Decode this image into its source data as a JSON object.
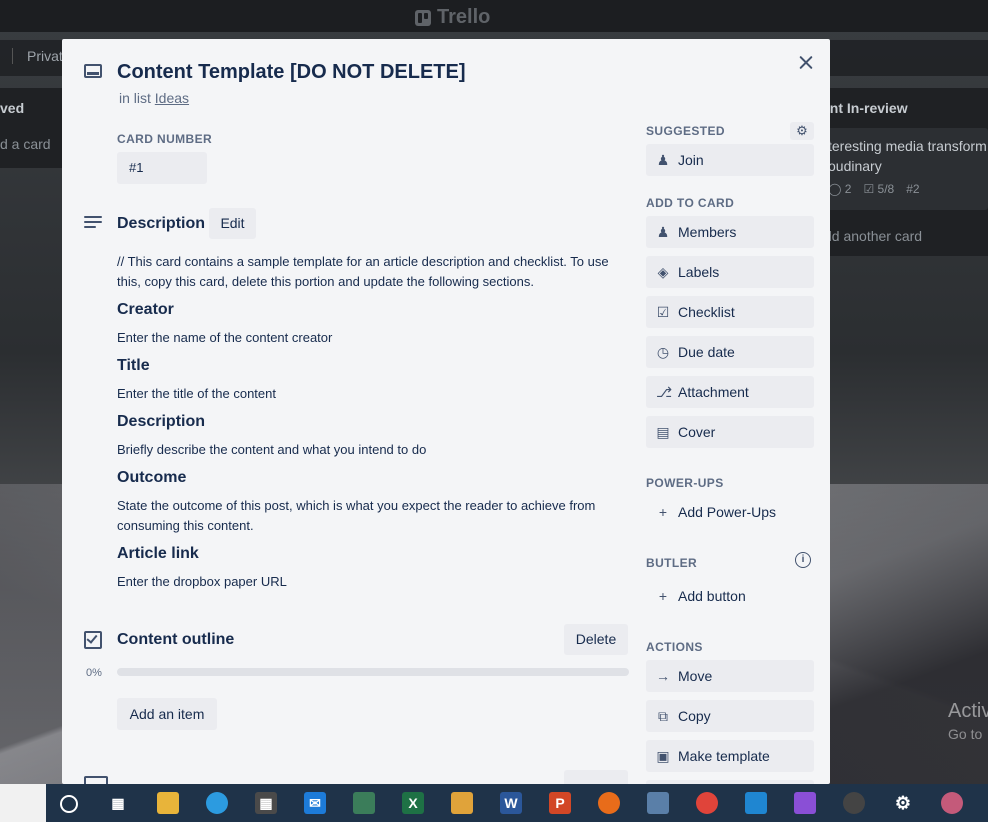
{
  "app": {
    "logo_text": "Trello"
  },
  "board": {
    "private_label": "Private",
    "left_list": {
      "title": "ved",
      "add_card": "d a card"
    },
    "right_list": {
      "title": "ent In-review",
      "card_title": "teresting media transform\noudinary",
      "card_comments": "2",
      "card_checklist": "5/8",
      "card_number": "#2",
      "add_card": "dd another card"
    }
  },
  "modal": {
    "title": "Content Template [DO NOT DELETE]",
    "in_list_prefix": "in list",
    "list_name": "Ideas",
    "card_number_label": "CARD NUMBER",
    "card_number_value": "#1",
    "description": {
      "title": "Description",
      "edit_label": "Edit",
      "intro": "// This card contains a sample template for an article description and checklist. To use this, copy this card, delete this portion and update the following sections.",
      "sections": [
        {
          "heading": "Creator",
          "text": "Enter the name of the content creator"
        },
        {
          "heading": "Title",
          "text": "Enter the title of the content"
        },
        {
          "heading": "Description",
          "text": "Briefly describe the content and what you intend to do"
        },
        {
          "heading": "Outcome",
          "text": "State the outcome of this post, which is what you expect the reader to achieve from consuming this content."
        },
        {
          "heading": "Article link",
          "text": "Enter the dropbox paper URL"
        }
      ]
    },
    "checklist": {
      "title": "Content outline",
      "delete_label": "Delete",
      "percent_label": "0%",
      "progress": 0,
      "add_item_label": "Add an item"
    },
    "sidebar": {
      "suggested_label": "SUGGESTED",
      "join": "Join",
      "add_to_card_label": "ADD TO CARD",
      "members": "Members",
      "labels": "Labels",
      "checklist": "Checklist",
      "due_date": "Due date",
      "attachment": "Attachment",
      "cover": "Cover",
      "powerups_label": "POWER-UPS",
      "add_powerups": "Add Power-Ups",
      "butler_label": "BUTLER",
      "add_button": "Add button",
      "actions_label": "ACTIONS",
      "move": "Move",
      "copy": "Copy",
      "make_template": "Make template"
    }
  },
  "windows": {
    "activate_title": "Activ",
    "activate_sub": "Go to"
  }
}
